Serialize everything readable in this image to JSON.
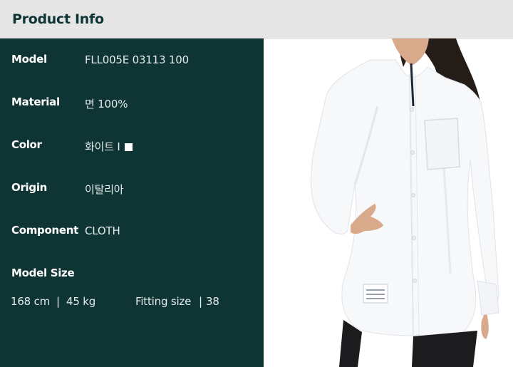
{
  "header": {
    "title": "Product Info"
  },
  "specs": [
    {
      "label": "Model",
      "value": "FLL005E 03113 100"
    },
    {
      "label": "Material",
      "value": "면 100%"
    },
    {
      "label": "Color",
      "value": "화이트 I"
    },
    {
      "label": "Origin",
      "value": "이탈리아"
    },
    {
      "label": "Component",
      "value": "CLOTH"
    }
  ],
  "model_size": {
    "label": "Model Size",
    "height": "168 cm",
    "sep1": "|",
    "weight": "45 kg",
    "fitting_label": "Fitting size",
    "sep2": "|",
    "fitting_value": "38"
  },
  "colors": {
    "panel_bg": "#0f3434",
    "header_bg": "#e6e6e6",
    "swatch": "#ffffff"
  }
}
